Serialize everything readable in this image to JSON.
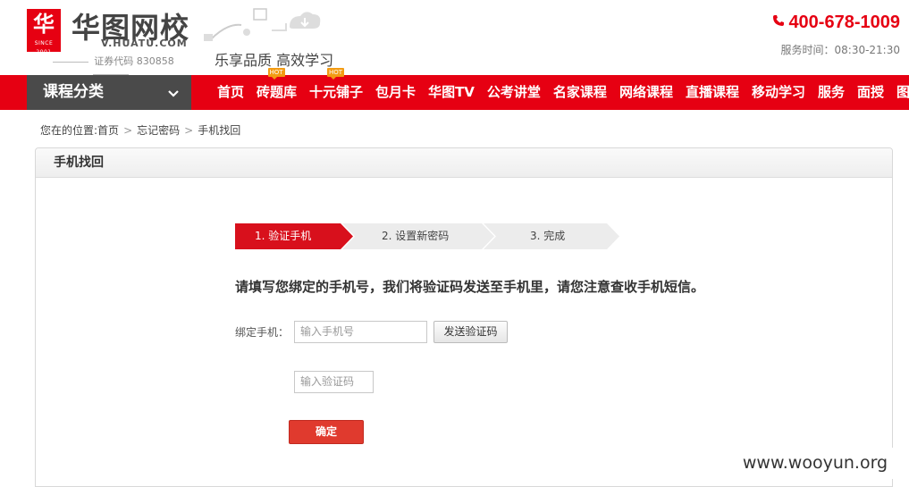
{
  "header": {
    "logo_glyph": "华",
    "logo_since": "SINCE 2001",
    "brand_name": "华图网校",
    "brand_domain": "V.HUATU.COM",
    "stock_code": "证券代码 830858",
    "slogan": "乐享品质  高效学习",
    "hotline": "400-678-1009",
    "service_hours": "服务时间：08:30-21:30"
  },
  "nav": {
    "category_label": "课程分类",
    "items": [
      {
        "label": "首页"
      },
      {
        "label": "砖题库",
        "badge": "HOT"
      },
      {
        "label": "十元铺子",
        "badge": "HOT"
      },
      {
        "label": "包月卡"
      },
      {
        "label": "华图TV"
      },
      {
        "label": "公考讲堂"
      },
      {
        "label": "名家课程"
      },
      {
        "label": "网络课程"
      },
      {
        "label": "直播课程"
      },
      {
        "label": "移动学习"
      },
      {
        "label": "服务"
      },
      {
        "label": "面授"
      },
      {
        "label": "图书"
      }
    ]
  },
  "breadcrumb": {
    "prefix": "您在的位置:",
    "items": [
      "首页",
      "忘记密码",
      "手机找回"
    ]
  },
  "panel": {
    "title": "手机找回",
    "steps": [
      {
        "label": "1. 验证手机",
        "active": true
      },
      {
        "label": "2. 设置新密码",
        "active": false
      },
      {
        "label": "3. 完成",
        "active": false
      }
    ],
    "instruction": "请填写您绑定的手机号，我们将验证码发送至手机里，请您注意查收手机短信。",
    "phone_label": "绑定手机：",
    "phone_placeholder": "输入手机号",
    "send_code_label": "发送验证码",
    "code_placeholder": "输入验证码",
    "confirm_label": "确定"
  },
  "watermark": "www.wooyun.org",
  "colors": {
    "brand_red": "#e60012",
    "nav_dark": "#4a4a4a",
    "hot_badge": "#f39b12"
  }
}
